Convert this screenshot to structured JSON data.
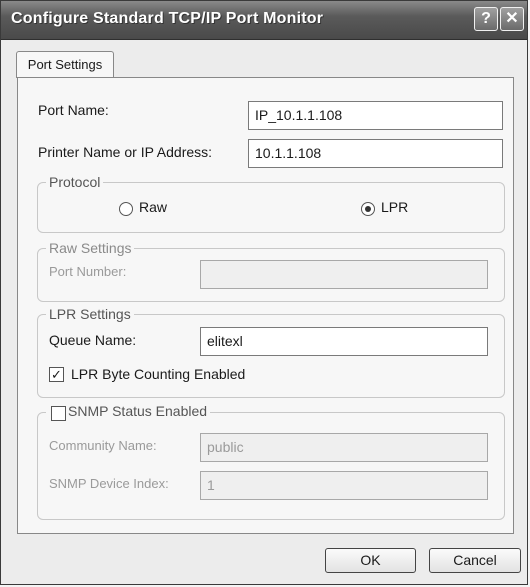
{
  "window": {
    "title": "Configure Standard TCP/IP Port Monitor",
    "help_glyph": "?",
    "close_glyph": "✕"
  },
  "tabs": [
    {
      "label": "Port Settings"
    }
  ],
  "port_name": {
    "label": "Port Name:",
    "value": "IP_10.1.1.108"
  },
  "printer_address": {
    "label": "Printer Name or IP Address:",
    "value": "10.1.1.108"
  },
  "protocol": {
    "legend": "Protocol",
    "options": [
      {
        "label": "Raw",
        "selected": false
      },
      {
        "label": "LPR",
        "selected": true
      }
    ]
  },
  "raw_settings": {
    "legend": "Raw Settings",
    "port_number_label": "Port Number:",
    "port_number_value": ""
  },
  "lpr_settings": {
    "legend": "LPR Settings",
    "queue_name_label": "Queue Name:",
    "queue_name_value": "elitexl",
    "byte_counting_label": "LPR Byte Counting Enabled",
    "byte_counting_checked": true,
    "check_glyph": "✓"
  },
  "snmp": {
    "legend": "SNMP Status Enabled",
    "enabled": false,
    "community_label": "Community Name:",
    "community_value": "public",
    "device_index_label": "SNMP Device Index:",
    "device_index_value": "1"
  },
  "buttons": {
    "ok": "OK",
    "cancel": "Cancel"
  }
}
